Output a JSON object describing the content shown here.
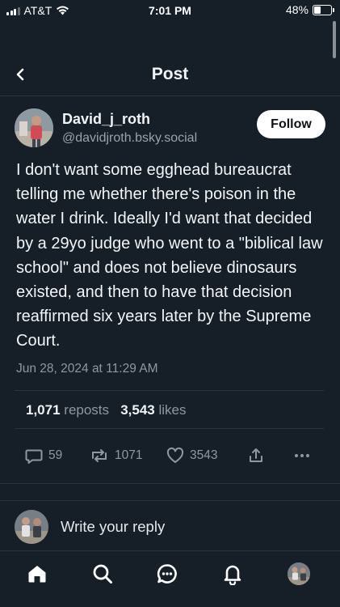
{
  "status_bar": {
    "carrier": "AT&T",
    "time": "7:01 PM",
    "battery": "48%",
    "battery_level": 0.48
  },
  "header": {
    "title": "Post",
    "back_icon": "chevron-left-icon"
  },
  "post": {
    "author_name": "David_j_roth",
    "author_handle": "@davidjroth.bsky.social",
    "follow_label": "Follow",
    "text": "I don't want some egghead bureaucrat telling me whether there's poison in the water I drink. Ideally I'd want that decided by a 29yo judge who went to a \"biblical law school\" and does not believe dinosaurs existed, and then to have that decision reaffirmed six years later by the Supreme Court.",
    "timestamp": "Jun 28, 2024 at 11:29 AM",
    "reposts_count": "1,071",
    "reposts_label": "reposts",
    "likes_count": "3,543",
    "likes_label": "likes"
  },
  "actions": {
    "reply_count": "59",
    "repost_count": "1071",
    "like_count": "3543"
  },
  "reply": {
    "placeholder": "Write your reply"
  },
  "tabbar": {
    "items": [
      "home-icon",
      "search-icon",
      "chat-icon",
      "bell-icon",
      "profile-avatar"
    ]
  },
  "colors": {
    "background": "#161e27",
    "divider": "#2b3440",
    "muted_text": "#8e98a3",
    "follow_bg": "#ffffff"
  }
}
